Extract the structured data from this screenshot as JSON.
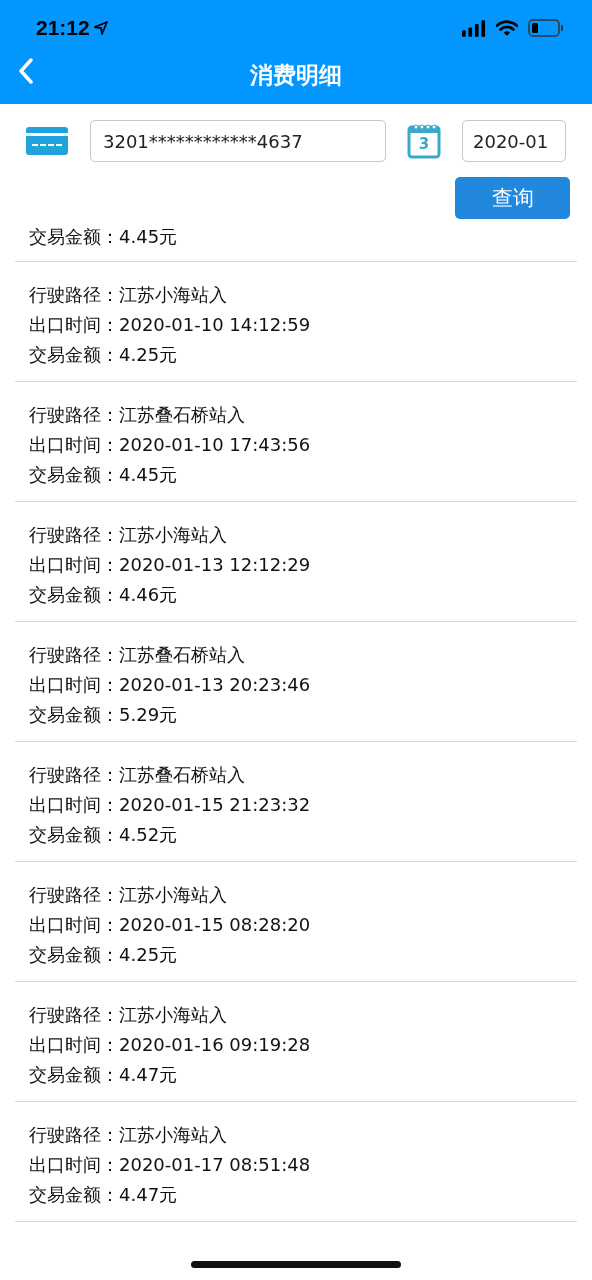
{
  "status_bar": {
    "time": "21:12"
  },
  "nav": {
    "title": "消费明细"
  },
  "filter": {
    "card_number": "3201************4637",
    "calendar_day": "3",
    "month": "2020-01",
    "query_button": "查询"
  },
  "records": [
    {
      "lines": [
        "交易金额：4.45元"
      ]
    },
    {
      "lines": [
        "行驶路径：江苏小海站入",
        "出口时间：2020-01-10 14:12:59",
        "交易金额：4.25元"
      ]
    },
    {
      "lines": [
        "行驶路径：江苏叠石桥站入",
        "出口时间：2020-01-10 17:43:56",
        "交易金额：4.45元"
      ]
    },
    {
      "lines": [
        "行驶路径：江苏小海站入",
        "出口时间：2020-01-13 12:12:29",
        "交易金额：4.46元"
      ]
    },
    {
      "lines": [
        "行驶路径：江苏叠石桥站入",
        "出口时间：2020-01-13 20:23:46",
        "交易金额：5.29元"
      ]
    },
    {
      "lines": [
        "行驶路径：江苏叠石桥站入",
        "出口时间：2020-01-15 21:23:32",
        "交易金额：4.52元"
      ]
    },
    {
      "lines": [
        "行驶路径：江苏小海站入",
        "出口时间：2020-01-15 08:28:20",
        "交易金额：4.25元"
      ]
    },
    {
      "lines": [
        "行驶路径：江苏小海站入",
        "出口时间：2020-01-16 09:19:28",
        "交易金额：4.47元"
      ]
    },
    {
      "lines": [
        "行驶路径：江苏小海站入",
        "出口时间：2020-01-17 08:51:48",
        "交易金额：4.47元"
      ]
    }
  ]
}
